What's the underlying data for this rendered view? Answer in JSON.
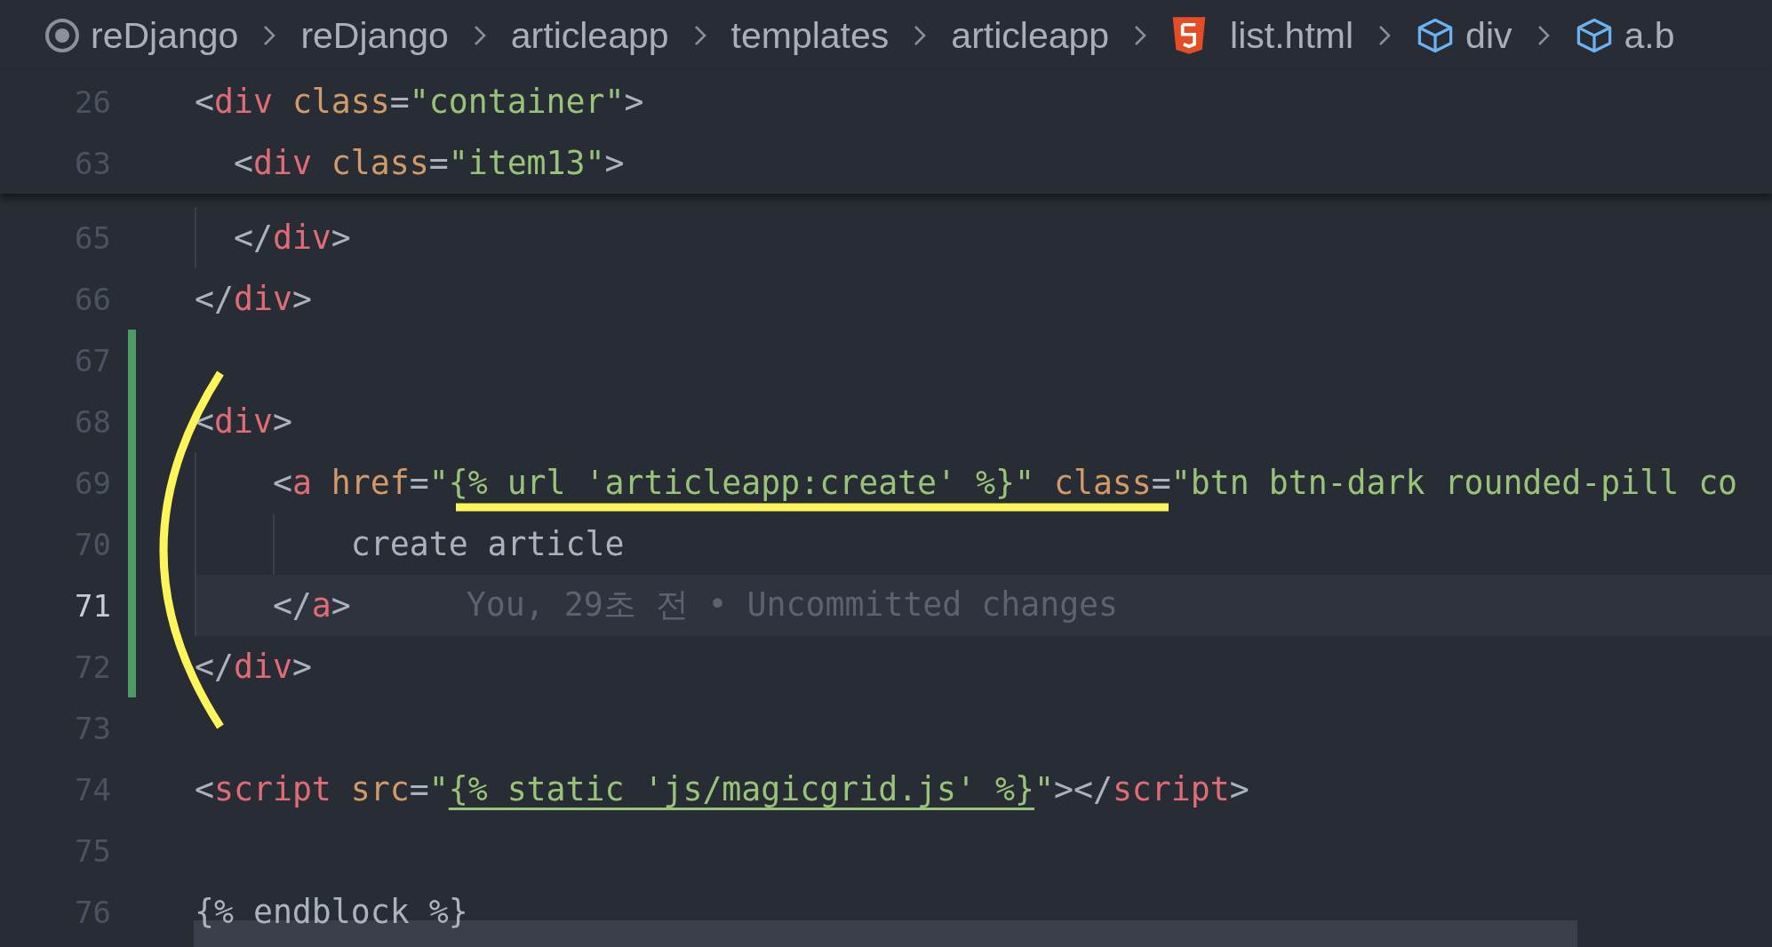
{
  "breadcrumbs": [
    {
      "kind": "root",
      "label": "reDjango"
    },
    {
      "kind": "folder",
      "label": "reDjango"
    },
    {
      "kind": "folder",
      "label": "articleapp"
    },
    {
      "kind": "folder",
      "label": "templates"
    },
    {
      "kind": "folder",
      "label": "articleapp"
    },
    {
      "kind": "html-file",
      "label": "list.html"
    },
    {
      "kind": "element",
      "label": "div"
    },
    {
      "kind": "element",
      "label": "a.b"
    }
  ],
  "sticky_lines": [
    {
      "number": "26",
      "tokens": [
        {
          "kind": "punct",
          "text": "<"
        },
        {
          "kind": "tag",
          "text": "div"
        },
        {
          "kind": "attr",
          "text": " class"
        },
        {
          "kind": "punct",
          "text": "="
        },
        {
          "kind": "string",
          "text": "\"container\""
        },
        {
          "kind": "punct",
          "text": ">"
        }
      ]
    },
    {
      "number": "63",
      "tokens": [
        {
          "kind": "punct",
          "text": "  <"
        },
        {
          "kind": "tag",
          "text": "div"
        },
        {
          "kind": "attr",
          "text": " class"
        },
        {
          "kind": "punct",
          "text": "="
        },
        {
          "kind": "string",
          "text": "\"item13\""
        },
        {
          "kind": "punct",
          "text": ">"
        }
      ]
    }
  ],
  "lines": [
    {
      "number": "65",
      "changed": false,
      "current": false,
      "tokens": [
        {
          "kind": "punct",
          "text": "  </"
        },
        {
          "kind": "tag",
          "text": "div"
        },
        {
          "kind": "punct",
          "text": ">"
        }
      ]
    },
    {
      "number": "66",
      "changed": false,
      "current": false,
      "tokens": [
        {
          "kind": "punct",
          "text": "</"
        },
        {
          "kind": "tag",
          "text": "div"
        },
        {
          "kind": "punct",
          "text": ">"
        }
      ]
    },
    {
      "number": "67",
      "changed": true,
      "current": false
    },
    {
      "number": "68",
      "changed": true,
      "current": false,
      "tokens": [
        {
          "kind": "punct",
          "text": "<"
        },
        {
          "kind": "tag",
          "text": "div"
        },
        {
          "kind": "punct",
          "text": ">"
        }
      ]
    },
    {
      "number": "69",
      "changed": true,
      "current": false,
      "tokens": [
        {
          "kind": "punct",
          "text": "    <"
        },
        {
          "kind": "tag",
          "text": "a"
        },
        {
          "kind": "attr",
          "text": " href"
        },
        {
          "kind": "punct",
          "text": "="
        },
        {
          "kind": "string",
          "text": "\""
        },
        {
          "kind": "string",
          "text": "{% url 'articleapp:create' %}"
        },
        {
          "kind": "string",
          "text": "\""
        },
        {
          "kind": "attr",
          "text": " class"
        },
        {
          "kind": "punct",
          "text": "="
        },
        {
          "kind": "string",
          "text": "\"btn btn-dark rounded-pill co"
        }
      ]
    },
    {
      "number": "70",
      "changed": true,
      "current": false,
      "tokens": [
        {
          "kind": "text",
          "text": "        create article"
        }
      ]
    },
    {
      "number": "71",
      "changed": true,
      "current": true,
      "blame": "You, 29초 전 • Uncommitted changes",
      "tokens": [
        {
          "kind": "punct",
          "text": "    </"
        },
        {
          "kind": "tag",
          "text": "a"
        },
        {
          "kind": "punct",
          "text": ">"
        }
      ]
    },
    {
      "number": "72",
      "changed": true,
      "current": false,
      "tokens": [
        {
          "kind": "punct",
          "text": "</"
        },
        {
          "kind": "tag",
          "text": "div"
        },
        {
          "kind": "punct",
          "text": ">"
        }
      ]
    },
    {
      "number": "73",
      "changed": false,
      "current": false
    },
    {
      "number": "74",
      "changed": false,
      "current": false,
      "tokens": [
        {
          "kind": "punct",
          "text": "<"
        },
        {
          "kind": "tag",
          "text": "script"
        },
        {
          "kind": "attr",
          "text": " src"
        },
        {
          "kind": "punct",
          "text": "="
        },
        {
          "kind": "string",
          "text": "\""
        },
        {
          "kind": "template",
          "text": "{% static 'js/magicgrid.js' %}"
        },
        {
          "kind": "string",
          "text": "\""
        },
        {
          "kind": "punct",
          "text": "></"
        },
        {
          "kind": "tag",
          "text": "script"
        },
        {
          "kind": "punct",
          "text": ">"
        }
      ]
    },
    {
      "number": "75",
      "changed": false,
      "current": false
    },
    {
      "number": "76",
      "changed": false,
      "current": false,
      "tokens": [
        {
          "kind": "text",
          "text": "{% endblock %}"
        }
      ]
    }
  ]
}
